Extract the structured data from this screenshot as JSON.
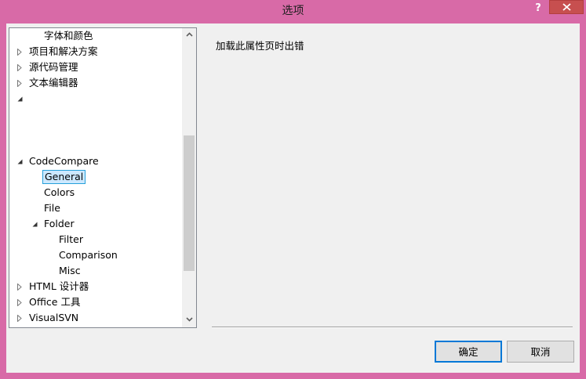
{
  "window": {
    "title": "选项",
    "help_label": "?"
  },
  "tree": {
    "items": [
      {
        "label": "字体和颜色",
        "indent": 1,
        "toggle": "none"
      },
      {
        "label": "项目和解决方案",
        "indent": 0,
        "toggle": "collapsed"
      },
      {
        "label": "源代码管理",
        "indent": 0,
        "toggle": "collapsed"
      },
      {
        "label": "文本编辑器",
        "indent": 0,
        "toggle": "collapsed"
      },
      {
        "label": "",
        "indent": 0,
        "toggle": "expanded"
      },
      {
        "label": "",
        "indent": 0,
        "toggle": "none"
      },
      {
        "label": "",
        "indent": 0,
        "toggle": "none"
      },
      {
        "label": "",
        "indent": 0,
        "toggle": "none"
      },
      {
        "label": "CodeCompare",
        "indent": 0,
        "toggle": "expanded"
      },
      {
        "label": "General",
        "indent": 1,
        "toggle": "none",
        "selected": true
      },
      {
        "label": "Colors",
        "indent": 1,
        "toggle": "none"
      },
      {
        "label": "File",
        "indent": 1,
        "toggle": "none"
      },
      {
        "label": "Folder",
        "indent": 1,
        "toggle": "expanded"
      },
      {
        "label": "Filter",
        "indent": 2,
        "toggle": "none"
      },
      {
        "label": "Comparison",
        "indent": 2,
        "toggle": "none"
      },
      {
        "label": "Misc",
        "indent": 2,
        "toggle": "none"
      },
      {
        "label": "HTML 设计器",
        "indent": 0,
        "toggle": "collapsed"
      },
      {
        "label": "Office 工具",
        "indent": 0,
        "toggle": "collapsed"
      },
      {
        "label": "VisualSVN",
        "indent": 0,
        "toggle": "collapsed"
      }
    ]
  },
  "content": {
    "error_message": "加载此属性页时出错"
  },
  "buttons": {
    "ok_label": "确定",
    "cancel_label": "取消"
  },
  "colors": {
    "frame": "#d86aa7",
    "close_button": "#c74f4f",
    "selection_fill": "#cce8ff",
    "selection_border": "#26a0da",
    "default_button_border": "#0078d7"
  },
  "icons": {
    "collapsed": "triangle-right-outline-icon",
    "expanded": "triangle-down-filled-icon",
    "close": "x-icon",
    "scroll_up": "chevron-up-icon",
    "scroll_down": "chevron-down-icon"
  }
}
